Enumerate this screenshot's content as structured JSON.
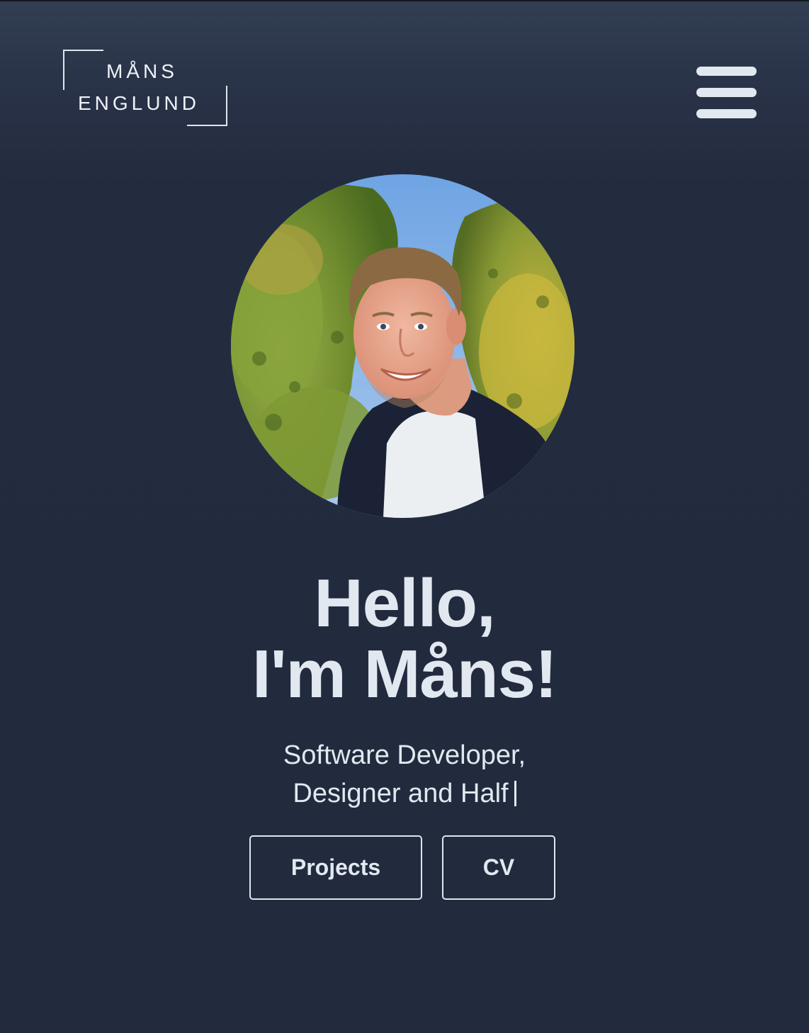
{
  "logo": {
    "line1": "MÅNS",
    "line2": "ENGLUND"
  },
  "nav": {
    "menu_icon": "hamburger-menu-icon"
  },
  "hero": {
    "greeting_line1": "Hello,",
    "greeting_line2": "I'm Måns!",
    "tagline_line1": "Software Developer,",
    "tagline_line2": "Designer and Half"
  },
  "actions": {
    "projects_label": "Projects",
    "cv_label": "CV"
  },
  "colors": {
    "background": "#222a3d",
    "text": "#e2e8f0"
  }
}
